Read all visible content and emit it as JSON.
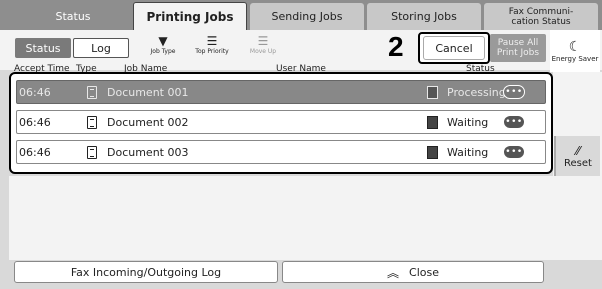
{
  "tabs": {
    "status": "Status",
    "printing": "Printing Jobs",
    "sending": "Sending Jobs",
    "storing": "Storing Jobs",
    "fax_line1": "Fax Communi-",
    "fax_line2": "cation Status"
  },
  "subbar": {
    "status_toggle": "Status",
    "log_toggle": "Log",
    "job_type": "Job Type",
    "top_priority": "Top Priority",
    "move_up": "Move Up",
    "callout": "2",
    "cancel": "Cancel",
    "pause_line1": "Pause All",
    "pause_line2": "Print Jobs",
    "energy_saver": "Energy Saver"
  },
  "columns": {
    "accept_time": "Accept Time",
    "type": "Type",
    "job_name": "Job Name",
    "user_name": "User Name",
    "status": "Status"
  },
  "jobs": [
    {
      "time": "06:46",
      "name": "Document 001",
      "status": "Processing",
      "more": "•••",
      "selected": true
    },
    {
      "time": "06:46",
      "name": "Document 002",
      "status": "Waiting",
      "more": "•••",
      "selected": false
    },
    {
      "time": "06:46",
      "name": "Document 003",
      "status": "Waiting",
      "more": "•••",
      "selected": false
    }
  ],
  "side": {
    "reset": "Reset"
  },
  "bottom": {
    "fax_log": "Fax Incoming/Outgoing Log",
    "close": "Close"
  },
  "icons": {
    "job_type": "funnel-icon",
    "top_priority": "priority-stack-icon",
    "move_up": "move-up-icon",
    "energy_saver": "moon-icon",
    "reset": "reset-slash-icon",
    "close": "double-chevron-up-icon",
    "document": "document-icon",
    "status": "printer-status-icon",
    "more": "more-dots-icon"
  }
}
